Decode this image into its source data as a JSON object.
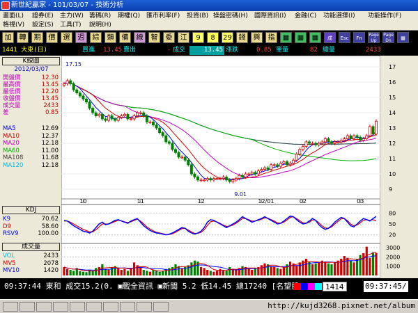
{
  "window": {
    "title": "新世紀贏家 - 101/03/07 - 技術分析"
  },
  "menu": {
    "row1": [
      "畫面(L)",
      "證券(E)",
      "主力(W)",
      "籌碼(R)",
      "期權(Q)",
      "匯市利率(F)",
      "投資(B)",
      "操盤密碼(H)",
      "國際資訊(I)",
      "金融(C)",
      "功能選擇(I)",
      "功能操作(F)"
    ],
    "row2": [
      "格視(V)",
      "設定(S)",
      "工具(T)",
      "說明(H)"
    ]
  },
  "toolbar": {
    "buttons": [
      "加",
      "轉",
      "期",
      "價",
      "選",
      "週",
      "綜",
      "類",
      "備",
      "線",
      "智",
      "委",
      "江",
      "9",
      "8",
      "29",
      "錢",
      "興",
      "指",
      "▦",
      "▦",
      "▦",
      "成",
      "Esc",
      "Fn",
      "Page Up",
      "Page Dn",
      "▦"
    ],
    "colors": [
      "#e8d890",
      "#e8d890",
      "#e8d890",
      "#e8d890",
      "#e8d890",
      "#d49ad8",
      "#e8d890",
      "#e8d890",
      "#e8d890",
      "#d49ad8",
      "#e8d890",
      "#e8d890",
      "#e8d890",
      "#ffff60",
      "#ffff60",
      "#ffff60",
      "#e8d890",
      "#e8d890",
      "#e8d890",
      "#40c060",
      "#40c060",
      "#40c060",
      "#6040c0",
      "#4040a0",
      "#4040a0",
      "#4040a0",
      "#4040a0",
      "#4040a0"
    ]
  },
  "quote": {
    "stock": "1441 大東(日)",
    "bid_label": "買進",
    "bid_value": "13.45",
    "ask_label": "賣出",
    "dash": "-",
    "trade_label": "成交",
    "trade_value": "13.45",
    "change_label": "漲跌",
    "change_value": "0.85",
    "lot_label": "單量",
    "lot_value": "82",
    "total_label": "總量",
    "total_value": "2433"
  },
  "left_panel": {
    "kline_title": "K線圖",
    "date": "2012/03/07",
    "ohlc": [
      {
        "label": "開盤價",
        "value": "12.30"
      },
      {
        "label": "最高價",
        "value": "13.45"
      },
      {
        "label": "最低價",
        "value": "12.20"
      },
      {
        "label": "收盤價",
        "value": "13.45"
      },
      {
        "label": "成交量",
        "value": "2433"
      },
      {
        "label": "差",
        "value": "0.85"
      }
    ],
    "ma": [
      {
        "label": "MA5",
        "value": "12.69",
        "color": "#0000ff"
      },
      {
        "label": "MA10",
        "value": "12.37",
        "color": "#d00000"
      },
      {
        "label": "MA20",
        "value": "12.18",
        "color": "#c000c0"
      },
      {
        "label": "MA60",
        "value": "11.00",
        "color": "#00b000"
      },
      {
        "label": "MA108",
        "value": "11.68",
        "color": "#404040"
      },
      {
        "label": "MA120",
        "value": "12.18",
        "color": "#00b8e0"
      }
    ],
    "kdj_title": "KDJ",
    "kdj": [
      {
        "label": "K9",
        "value": "70.62",
        "color": "#0000ff"
      },
      {
        "label": "D9",
        "value": "58.60",
        "color": "#d00000"
      },
      {
        "label": "RSV9",
        "value": "100.00",
        "color": "#0000ff"
      }
    ],
    "vol_title": "成交量",
    "vol": [
      {
        "label": "VOL",
        "value": "2433",
        "color": "#00b8e0"
      },
      {
        "label": "MV5",
        "value": "2078",
        "color": "#d00000"
      },
      {
        "label": "MV10",
        "value": "1420",
        "color": "#0000ff"
      }
    ]
  },
  "chart_data": {
    "type": "line",
    "price_axis": {
      "ticks": [
        9,
        10,
        11,
        12,
        13,
        14,
        15,
        16,
        17
      ],
      "ylim": [
        8.5,
        17.6
      ]
    },
    "kdj_axis": {
      "ticks": [
        20,
        50,
        80
      ],
      "ylim": [
        0,
        100
      ]
    },
    "vol_axis": {
      "ticks": [
        1000,
        2000,
        3000
      ],
      "ylim": [
        0,
        3300
      ]
    },
    "x_labels": [
      {
        "label": "10",
        "i": 6
      },
      {
        "label": "11",
        "i": 24
      },
      {
        "label": "12",
        "i": 43
      },
      {
        "label": "12/01",
        "i": 62
      },
      {
        "label": "02",
        "i": 75
      },
      {
        "label": "03",
        "i": 93
      }
    ],
    "annotations": [
      {
        "text": "17.15",
        "i": 0,
        "y": 17.15
      },
      {
        "text": "9.01",
        "i": 53,
        "y": 9.01
      }
    ],
    "n": 99,
    "close": [
      15.9,
      16.1,
      15.9,
      15.5,
      15.3,
      15.1,
      14.9,
      14.7,
      14.3,
      14.0,
      13.8,
      13.9,
      13.6,
      13.5,
      13.8,
      13.6,
      13.5,
      13.7,
      13.8,
      13.9,
      13.6,
      13.6,
      13.8,
      14.0,
      14.0,
      13.8,
      13.4,
      13.4,
      13.2,
      13.0,
      12.7,
      12.5,
      12.1,
      12.0,
      11.6,
      11.4,
      11.1,
      11.1,
      10.9,
      10.6,
      10.0,
      9.8,
      9.6,
      9.6,
      9.6,
      9.7,
      9.6,
      9.7,
      9.7,
      9.7,
      9.8,
      9.6,
      9.5,
      9.6,
      9.7,
      9.9,
      9.8,
      10.0,
      10.0,
      10.1,
      10.0,
      10.2,
      10.3,
      10.4,
      10.3,
      10.6,
      10.6,
      10.5,
      10.7,
      10.8,
      10.6,
      10.7,
      10.9,
      11.3,
      11.6,
      11.8,
      12.1,
      12.0,
      12.0,
      11.9,
      12.0,
      12.1,
      12.3,
      12.1,
      12.0,
      12.1,
      12.1,
      12.2,
      12.3,
      12.5,
      12.3,
      12.5,
      12.4,
      12.2,
      12.3,
      12.5,
      13.1,
      12.6,
      13.45
    ],
    "kdj_k": [
      60,
      58,
      52,
      45,
      40,
      35,
      30,
      28,
      25,
      30,
      40,
      50,
      55,
      48,
      50,
      55,
      60,
      62,
      58,
      55,
      52,
      58,
      62,
      65,
      55,
      45,
      38,
      32,
      28,
      25,
      24,
      22,
      20,
      22,
      25,
      30,
      35,
      40,
      38,
      30,
      25,
      22,
      25,
      30,
      40,
      55,
      62,
      60,
      55,
      50,
      45,
      40,
      45,
      50,
      55,
      62,
      70,
      65,
      60,
      55,
      58,
      62,
      65,
      70,
      65,
      60,
      55,
      50,
      52,
      58,
      65,
      72,
      70,
      62,
      55,
      50,
      52,
      58,
      65,
      60,
      48,
      40,
      35,
      38,
      45,
      55,
      62,
      68,
      65,
      55,
      45,
      42,
      50,
      58,
      65,
      62,
      58,
      65,
      70.62
    ],
    "kdj_d": [
      58,
      58,
      55,
      50,
      45,
      40,
      35,
      32,
      28,
      28,
      34,
      42,
      50,
      50,
      50,
      53,
      57,
      60,
      59,
      56,
      54,
      56,
      60,
      63,
      58,
      50,
      42,
      36,
      31,
      27,
      25,
      23,
      21,
      21,
      23,
      27,
      32,
      37,
      38,
      33,
      28,
      24,
      24,
      27,
      34,
      46,
      56,
      58,
      56,
      52,
      47,
      43,
      44,
      47,
      52,
      58,
      65,
      65,
      62,
      58,
      58,
      60,
      63,
      67,
      66,
      62,
      58,
      53,
      52,
      55,
      61,
      68,
      70,
      65,
      59,
      53,
      52,
      55,
      61,
      61,
      53,
      45,
      39,
      38,
      42,
      50,
      57,
      64,
      65,
      59,
      50,
      45,
      47,
      53,
      60,
      62,
      60,
      62,
      58.6
    ],
    "volume": [
      900,
      700,
      600,
      500,
      800,
      450,
      400,
      350,
      600,
      500,
      800,
      900,
      1200,
      700,
      600,
      900,
      1000,
      800,
      600,
      700,
      500,
      800,
      1400,
      1100,
      900,
      600,
      500,
      400,
      600,
      500,
      400,
      500,
      700,
      800,
      900,
      1200,
      1000,
      800,
      900,
      1100,
      1400,
      1600,
      1500,
      900,
      800,
      600,
      500,
      400,
      500,
      700,
      600,
      500,
      900,
      700,
      600,
      800,
      1000,
      900,
      700,
      600,
      800,
      900,
      1100,
      1300,
      1200,
      1000,
      900,
      800,
      700,
      900,
      1200,
      1500,
      1300,
      1100,
      1400,
      1600,
      1800,
      1500,
      1200,
      1300,
      1400,
      1600,
      1500,
      1300,
      1200,
      1400,
      1600,
      1800,
      2100,
      1900,
      1600,
      1400,
      1800,
      2200,
      2400,
      3100,
      1900,
      2500,
      2433
    ]
  },
  "status": {
    "text": "09:37:44 東和 成交15.2(0.  ▣戰全資訊 ▣新聞 5.2 低14.45 總17240 [名望股]",
    "code": "1414",
    "time": "09:37:45/"
  },
  "watermark": "http://kujd3268.pixnet.net/album"
}
